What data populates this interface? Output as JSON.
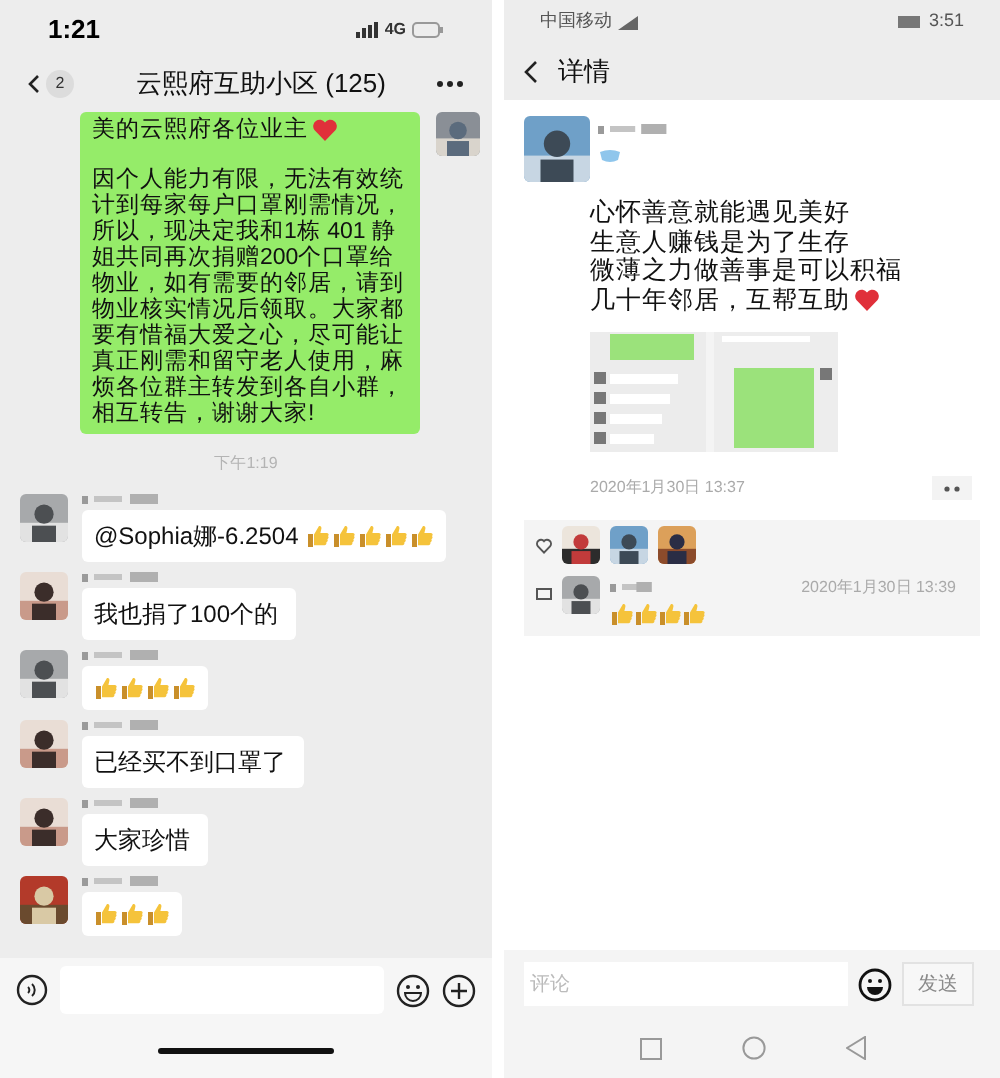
{
  "left": {
    "status_bar": {
      "time": "1:21",
      "network": "4G"
    },
    "header": {
      "back_count": "2",
      "title": "云熙府互助小区 (125)"
    },
    "own_message": {
      "paragraphs": [
        {
          "text": "美的云熙府各位业主",
          "emoji": [
            {
              "kind": "heart"
            }
          ]
        },
        {
          "text": "因个人能力有限，无法有效统计到每家每户口罩刚需情况，所以，现决定我和1栋 401 静姐共同再次捐赠200个口罩给物业，如有需要的邻居，请到物业核实情况后领取。大家都要有惜福大爱之心，尽可能让真正刚需和留守老人使用，麻烦各位群主转发到各自小群，相互转告，谢谢大家!"
        }
      ]
    },
    "timestamp": "下午1:19",
    "messages": [
      {
        "text": "@Sophia娜-6.2504",
        "emoji": [
          {
            "kind": "thumbs-up"
          },
          {
            "kind": "thumbs-up"
          },
          {
            "kind": "thumbs-up"
          },
          {
            "kind": "thumbs-up"
          },
          {
            "kind": "thumbs-up"
          }
        ]
      },
      {
        "text": "我也捐了100个的"
      },
      {
        "emoji": [
          {
            "kind": "thumbs-up"
          },
          {
            "kind": "thumbs-up"
          },
          {
            "kind": "thumbs-up"
          },
          {
            "kind": "thumbs-up"
          }
        ]
      },
      {
        "text": "已经买不到口罩了"
      },
      {
        "text": "大家珍惜"
      },
      {
        "emoji": [
          {
            "kind": "thumbs-up"
          },
          {
            "kind": "thumbs-up"
          },
          {
            "kind": "thumbs-up"
          }
        ]
      }
    ]
  },
  "right": {
    "status_bar": {
      "carrier": "中国移动",
      "time": "3:51"
    },
    "header": {
      "title": "详情"
    },
    "post": {
      "lines": [
        {
          "text": "心怀善意就能遇见美好"
        },
        {
          "text": "生意人赚钱是为了生存"
        },
        {
          "text": "微薄之力做善事是可以积福"
        },
        {
          "text": "几十年邻居，互帮互助",
          "emoji": [
            {
              "kind": "heart"
            }
          ]
        }
      ],
      "time": "2020年1月30日 13:37"
    },
    "comments": [
      {
        "time": "2020年1月30日 13:39",
        "emoji": [
          {
            "kind": "thumbs-up"
          },
          {
            "kind": "thumbs-up"
          },
          {
            "kind": "thumbs-up"
          },
          {
            "kind": "thumbs-up"
          }
        ]
      }
    ],
    "comment_bar": {
      "placeholder": "评论",
      "send": "发送",
      "send_disabled": true
    }
  }
}
